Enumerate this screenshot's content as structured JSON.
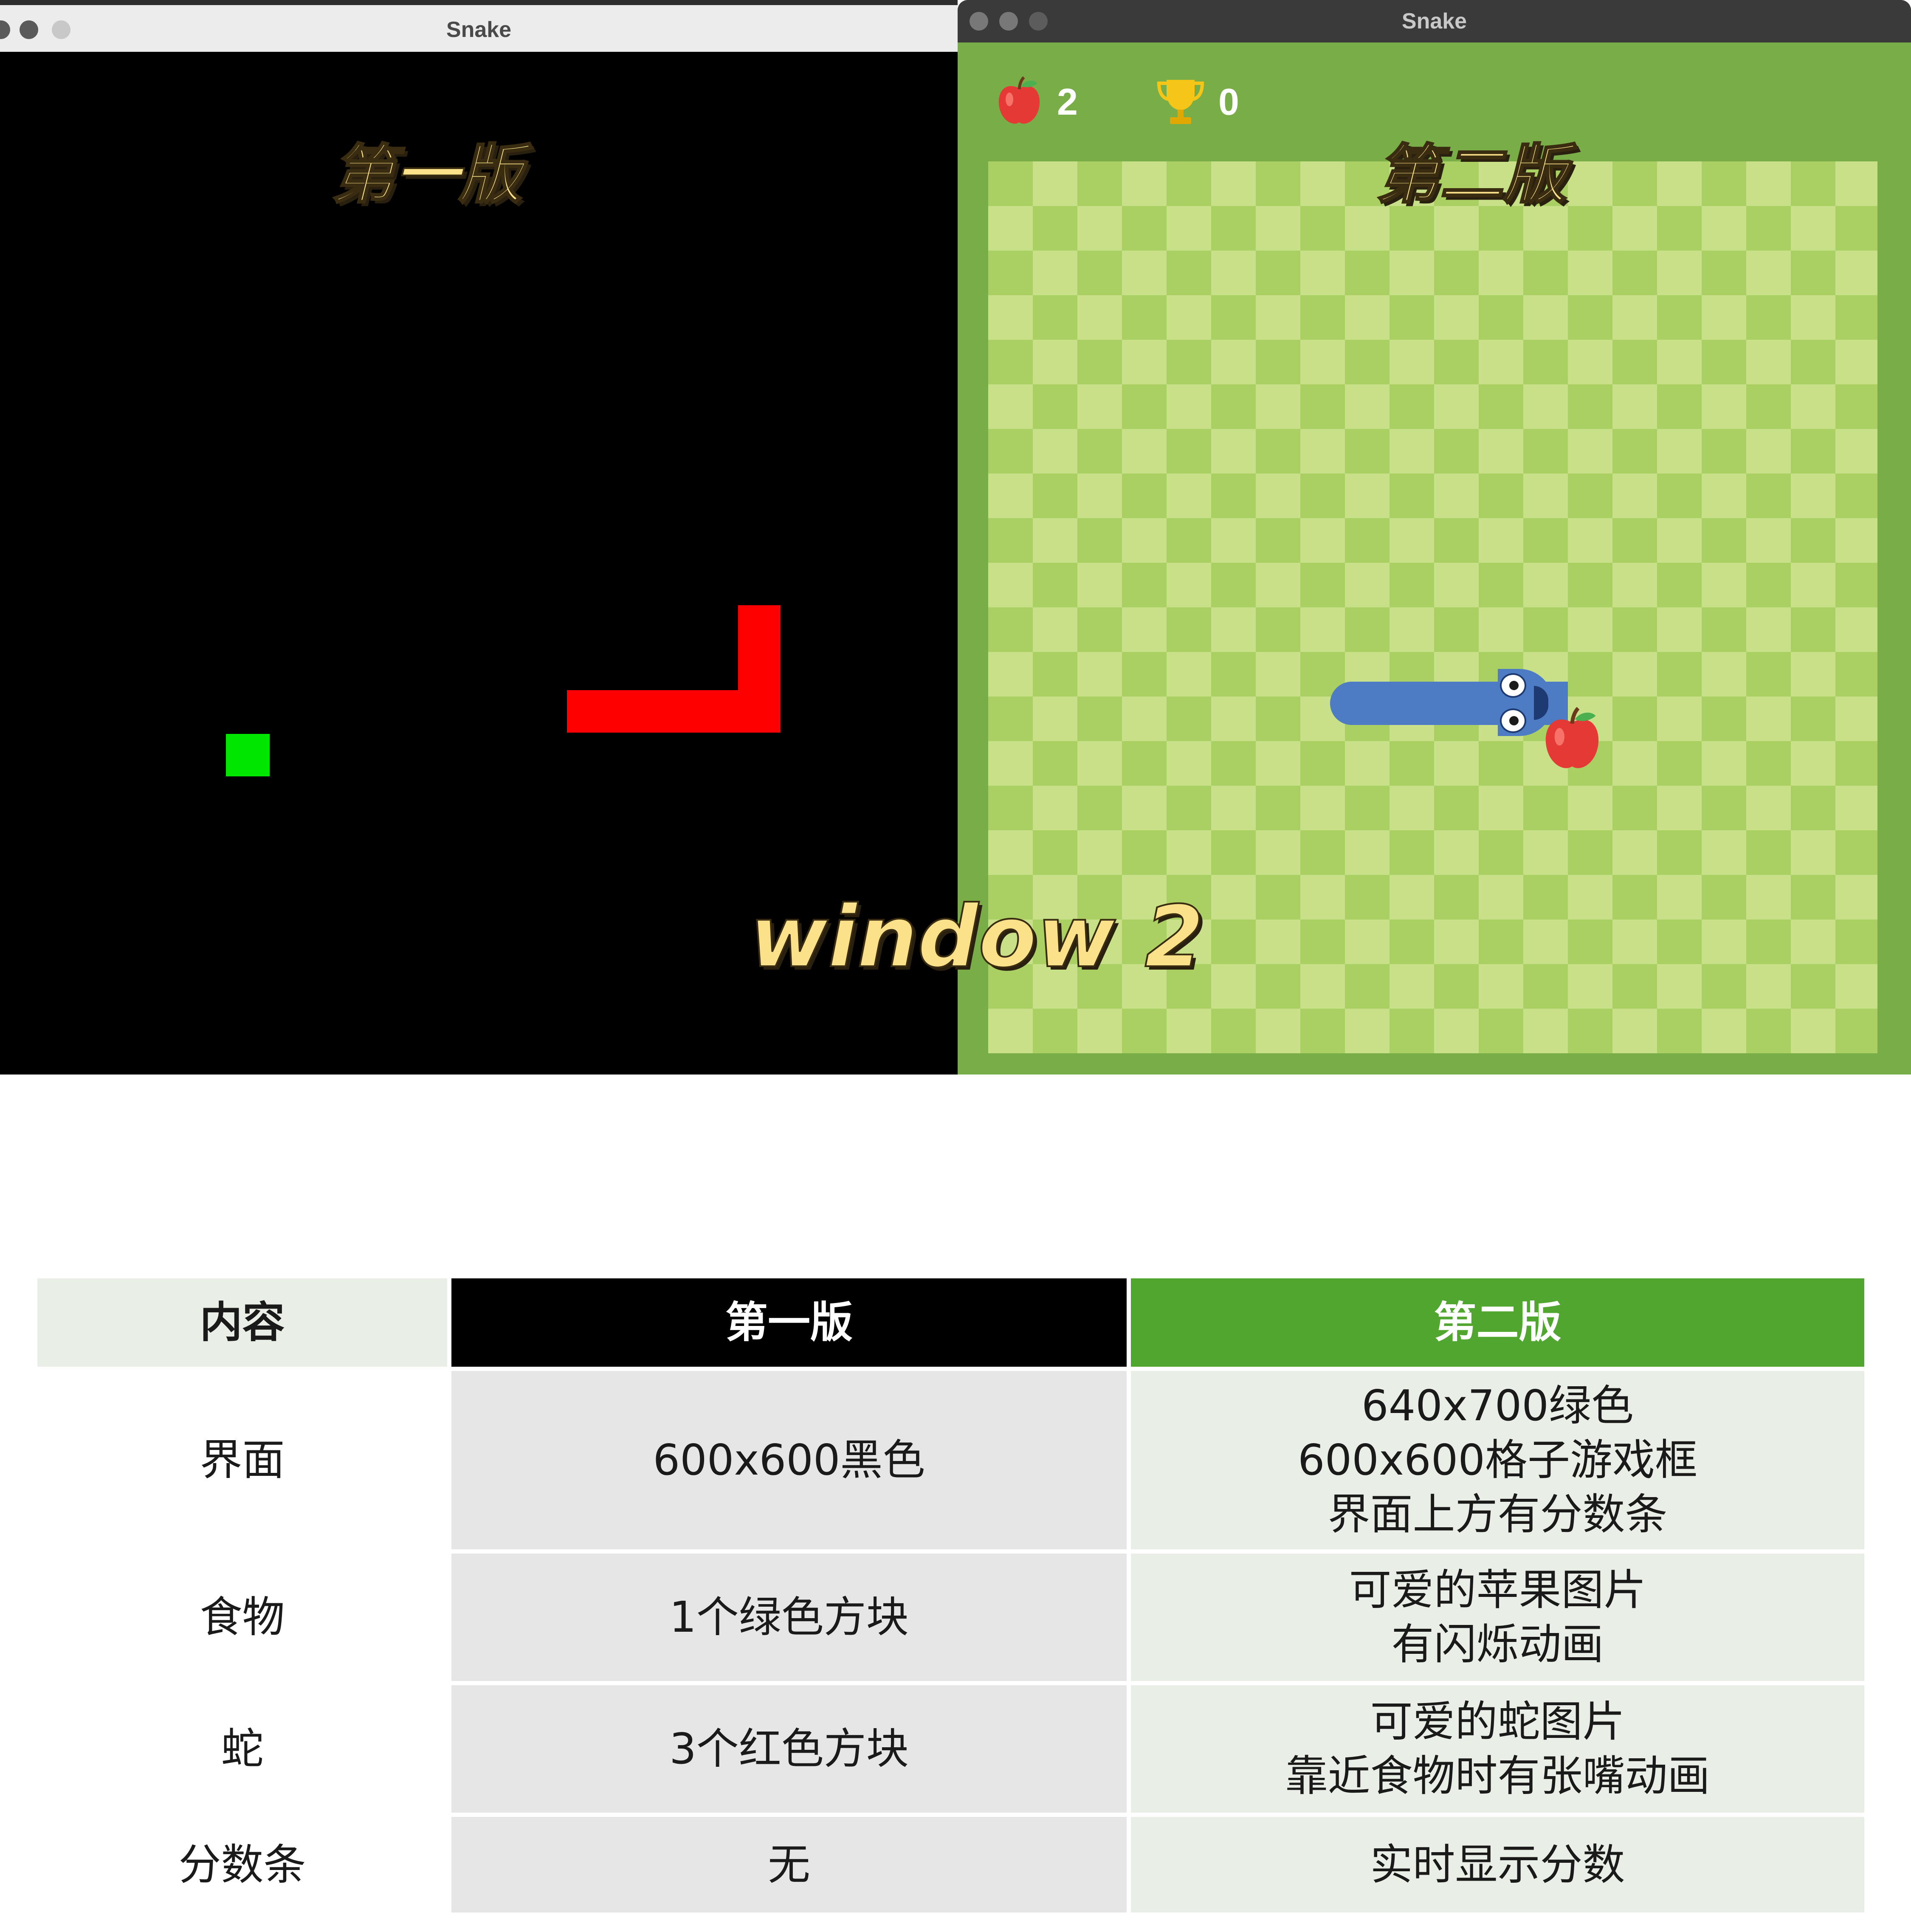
{
  "windows": {
    "v1": {
      "title": "Snake"
    },
    "v2": {
      "title": "Snake",
      "score": {
        "icon": "apple-icon",
        "value": "2"
      },
      "high_score": {
        "icon": "trophy-icon",
        "value": "0"
      }
    }
  },
  "captions": {
    "v1": "第一版",
    "v2": "第二版",
    "window": "window 2"
  },
  "colors": {
    "v1_background": "#000000",
    "v1_food": "#00e600",
    "v1_snake": "#ff0000",
    "v2_frame": "#79ad48",
    "v2_board_dark": "#aacf62",
    "v2_board_light": "#c8e189",
    "v2_snake": "#4d7cc5",
    "table_header_v1": "#000000",
    "table_header_v2": "#50a62f"
  },
  "table": {
    "headers": [
      "内容",
      "第一版",
      "第二版"
    ],
    "rows": [
      [
        "界面",
        "600x600黑色",
        "640x700绿色\n600x600格子游戏框\n界面上方有分数条"
      ],
      [
        "食物",
        "1个绿色方块",
        "可爱的苹果图片\n有闪烁动画"
      ],
      [
        "蛇",
        "3个红色方块",
        "可爱的蛇图片\n靠近食物时有张嘴动画"
      ],
      [
        "分数条",
        "无",
        "实时显示分数"
      ]
    ]
  }
}
